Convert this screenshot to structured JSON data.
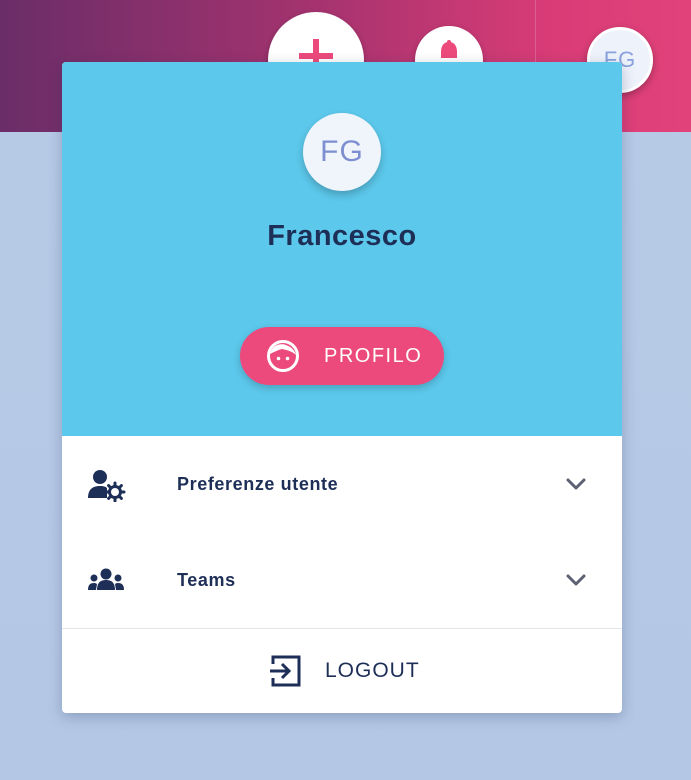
{
  "header": {
    "add_icon": "plus-icon",
    "bell_icon": "bell-icon",
    "avatar_initials": "FG"
  },
  "user_panel": {
    "avatar_initials": "FG",
    "name": "Francesco",
    "profile_button_label": "PROFILO",
    "profile_icon": "face-icon"
  },
  "menu": {
    "items": [
      {
        "label": "Preferenze utente",
        "icon": "user-settings-icon"
      },
      {
        "label": "Teams",
        "icon": "teams-icon"
      }
    ],
    "logout_label": "LOGOUT",
    "logout_icon": "logout-icon"
  },
  "colors": {
    "accent_pink": "#ec4a7c",
    "header_blue": "#5cc8eb",
    "text_dark": "#1e2f57",
    "avatar_text": "#7d8fd0"
  }
}
